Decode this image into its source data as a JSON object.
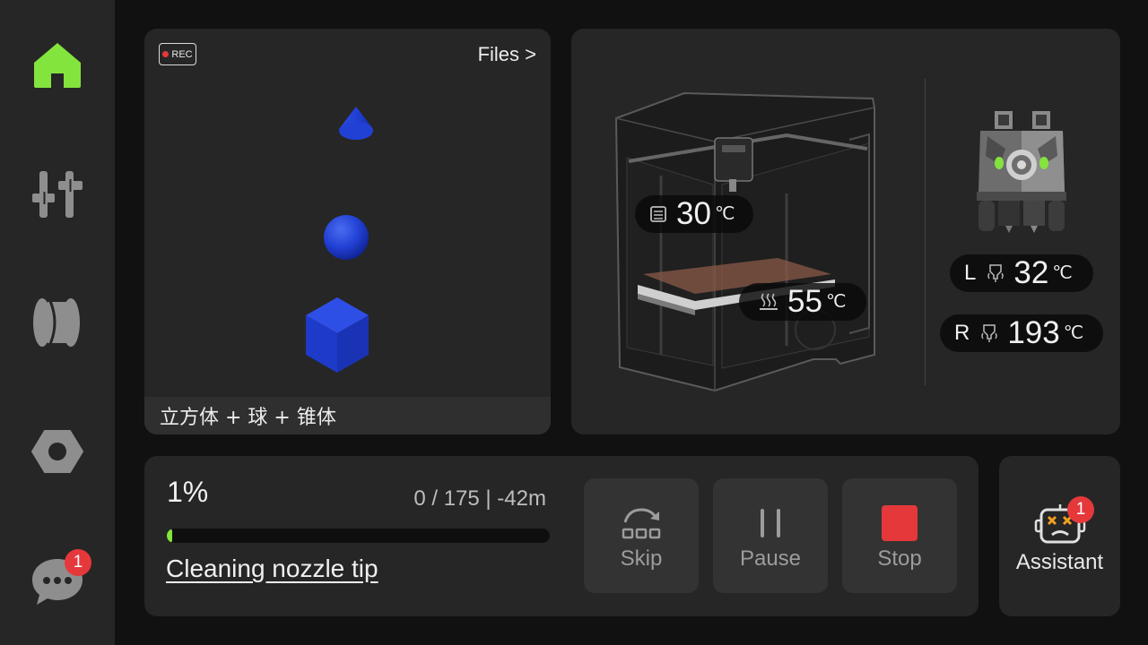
{
  "sidebar": {
    "items": [
      {
        "name": "home",
        "icon": "home-icon",
        "active": true
      },
      {
        "name": "controls",
        "icon": "sliders-icon"
      },
      {
        "name": "filament",
        "icon": "filament-spool-icon"
      },
      {
        "name": "settings",
        "icon": "hex-nut-icon"
      },
      {
        "name": "messages",
        "icon": "chat-bubble-icon",
        "badge": "1"
      }
    ]
  },
  "preview": {
    "rec_label": "REC",
    "files_label": "Files  >",
    "model_name": "立方体 + 球 + 锥体"
  },
  "temps": {
    "chamber": {
      "value": "30",
      "unit": "℃"
    },
    "bed": {
      "value": "55",
      "unit": "℃"
    },
    "left_nozzle": {
      "label": "L",
      "value": "32",
      "unit": "℃"
    },
    "right_nozzle": {
      "label": "R",
      "value": "193",
      "unit": "℃"
    }
  },
  "progress": {
    "percent_label": "1%",
    "percent": 1,
    "layers": "0 / 175  |  -42m",
    "stage": "Cleaning nozzle tip"
  },
  "actions": {
    "skip": "Skip",
    "pause": "Pause",
    "stop": "Stop"
  },
  "assistant": {
    "label": "Assistant",
    "badge": "1"
  },
  "colors": {
    "accent_green": "#84e43e",
    "stop_red": "#e5383b",
    "model_blue": "#2240d8"
  }
}
